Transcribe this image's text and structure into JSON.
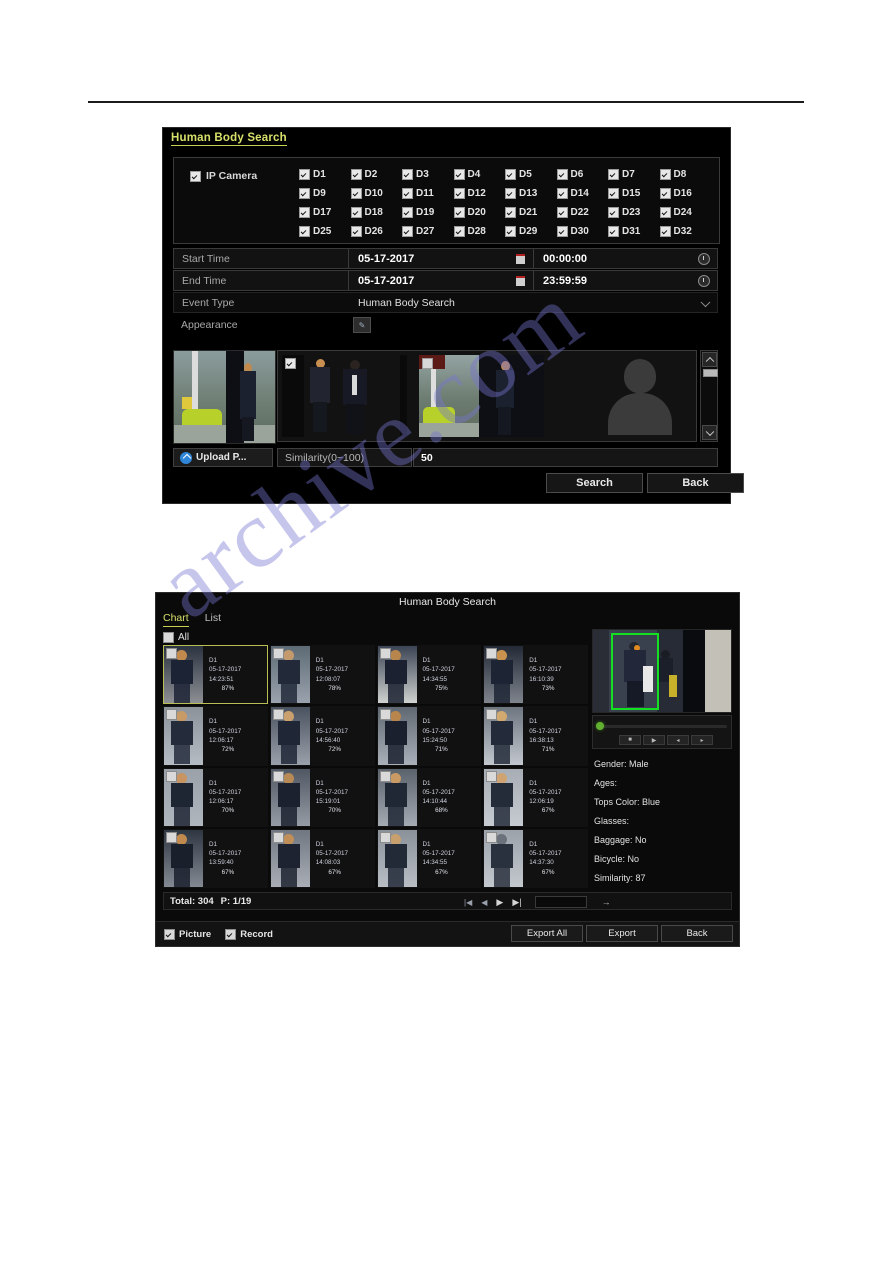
{
  "dialog1": {
    "title": "Human Body Search",
    "camera_section": {
      "ip_camera_label": "IP Camera",
      "ip_camera_checked": true,
      "channels": [
        "D1",
        "D2",
        "D3",
        "D4",
        "D5",
        "D6",
        "D7",
        "D8",
        "D9",
        "D10",
        "D11",
        "D12",
        "D13",
        "D14",
        "D15",
        "D16",
        "D17",
        "D18",
        "D19",
        "D20",
        "D21",
        "D22",
        "D23",
        "D24",
        "D25",
        "D26",
        "D27",
        "D28",
        "D29",
        "D30",
        "D31",
        "D32"
      ]
    },
    "fields": {
      "start_time_label": "Start Time",
      "start_date": "05-17-2017",
      "start_time": "00:00:00",
      "end_time_label": "End Time",
      "end_date": "05-17-2017",
      "end_time": "23:59:59",
      "event_type_label": "Event Type",
      "event_type_value": "Human Body Search",
      "appearance_label": "Appearance"
    },
    "upload_button": "Upload P...",
    "similarity_label": "Similarity(0~100)",
    "similarity_value": "50",
    "search_button": "Search",
    "back_button": "Back",
    "thumb_checked": [
      true,
      false
    ]
  },
  "dialog2": {
    "title": "Human Body Search",
    "tabs": [
      {
        "label": "Chart",
        "active": true
      },
      {
        "label": "List",
        "active": false
      }
    ],
    "select_all_label": "All",
    "select_all_checked": false,
    "results": [
      {
        "channel": "D1",
        "date": "05-17-2017",
        "time": "14:23:51",
        "similarity": "87%",
        "selected": true
      },
      {
        "channel": "D1",
        "date": "05-17-2017",
        "time": "12:08:07",
        "similarity": "78%",
        "selected": false
      },
      {
        "channel": "D1",
        "date": "05-17-2017",
        "time": "14:34:55",
        "similarity": "75%",
        "selected": false
      },
      {
        "channel": "D1",
        "date": "05-17-2017",
        "time": "16:10:39",
        "similarity": "73%",
        "selected": false
      },
      {
        "channel": "D1",
        "date": "05-17-2017",
        "time": "12:06:17",
        "similarity": "72%",
        "selected": false
      },
      {
        "channel": "D1",
        "date": "05-17-2017",
        "time": "14:56:40",
        "similarity": "72%",
        "selected": false
      },
      {
        "channel": "D1",
        "date": "05-17-2017",
        "time": "15:24:50",
        "similarity": "71%",
        "selected": false
      },
      {
        "channel": "D1",
        "date": "05-17-2017",
        "time": "16:38:13",
        "similarity": "71%",
        "selected": false
      },
      {
        "channel": "D1",
        "date": "05-17-2017",
        "time": "12:06:17",
        "similarity": "70%",
        "selected": false
      },
      {
        "channel": "D1",
        "date": "05-17-2017",
        "time": "15:19:01",
        "similarity": "70%",
        "selected": false
      },
      {
        "channel": "D1",
        "date": "05-17-2017",
        "time": "14:10:44",
        "similarity": "68%",
        "selected": false
      },
      {
        "channel": "D1",
        "date": "05-17-2017",
        "time": "12:06:19",
        "similarity": "67%",
        "selected": false
      },
      {
        "channel": "D1",
        "date": "05-17-2017",
        "time": "13:59:40",
        "similarity": "67%",
        "selected": false
      },
      {
        "channel": "D1",
        "date": "05-17-2017",
        "time": "14:08:03",
        "similarity": "67%",
        "selected": false
      },
      {
        "channel": "D1",
        "date": "05-17-2017",
        "time": "14:34:55",
        "similarity": "67%",
        "selected": false
      },
      {
        "channel": "D1",
        "date": "05-17-2017",
        "time": "14:37:30",
        "similarity": "67%",
        "selected": false
      }
    ],
    "detail": {
      "attributes": [
        "Gender: Male",
        "Ages:",
        "Tops Color: Blue",
        "Glasses:",
        "Baggage: No",
        "Bicycle: No",
        "Similarity: 87"
      ],
      "highlight_color": "#12e020"
    },
    "playback_controls": [
      "stop-icon",
      "play-icon",
      "prev-frame-icon",
      "next-frame-icon"
    ],
    "footer": {
      "total_label": "Total: 304",
      "page_label": "P: 1/19",
      "pager_icons": [
        "first-page-icon",
        "prev-page-icon",
        "next-page-icon",
        "last-page-icon"
      ],
      "page_input_value": "",
      "go_label": "→",
      "picture_label": "Picture",
      "picture_checked": true,
      "record_label": "Record",
      "record_checked": true,
      "export_all_button": "Export All",
      "export_button": "Export",
      "back_button": "Back"
    }
  },
  "watermark": {
    "text": "archive.com"
  }
}
